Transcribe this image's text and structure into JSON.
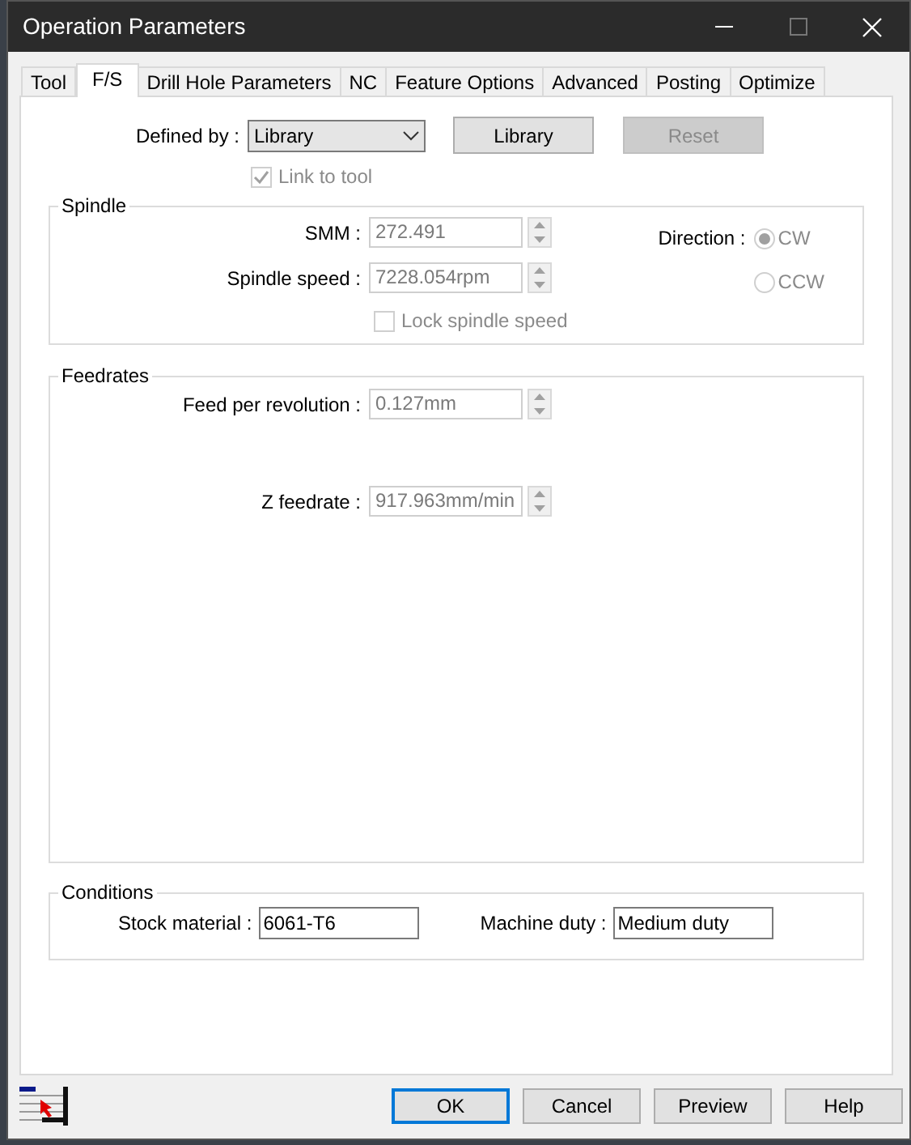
{
  "window": {
    "title": "Operation Parameters"
  },
  "tabs": [
    {
      "label": "Tool",
      "selected": false
    },
    {
      "label": "F/S",
      "selected": true
    },
    {
      "label": "Drill Hole Parameters",
      "selected": false
    },
    {
      "label": "NC",
      "selected": false
    },
    {
      "label": "Feature Options",
      "selected": false
    },
    {
      "label": "Advanced",
      "selected": false
    },
    {
      "label": "Posting",
      "selected": false
    },
    {
      "label": "Optimize",
      "selected": false
    }
  ],
  "defined_by": {
    "label": "Defined by :",
    "value": "Library"
  },
  "top_buttons": [
    {
      "label": "Library",
      "disabled": false
    },
    {
      "label": "Reset",
      "disabled": true
    }
  ],
  "link_to_tool": {
    "label": "Link to tool",
    "checked": true,
    "disabled": true
  },
  "spindle": {
    "title": "Spindle",
    "fields": [
      {
        "label": "SMM :",
        "value": "272.491",
        "disabled": true
      },
      {
        "label": "Spindle speed :",
        "value": "7228.054rpm",
        "disabled": true
      }
    ],
    "lock_spindle_speed": {
      "label": "Lock spindle speed",
      "checked": false,
      "disabled": true
    },
    "direction": {
      "label": "Direction :",
      "options": [
        {
          "label": "CW",
          "selected": true
        },
        {
          "label": "CCW",
          "selected": false
        }
      ]
    }
  },
  "feedrates": {
    "title": "Feedrates",
    "fields": [
      {
        "label": "Feed per revolution :",
        "value": "0.127mm",
        "disabled": true
      },
      {
        "label": "Z feedrate :",
        "value": "917.963mm/min",
        "disabled": true
      }
    ]
  },
  "conditions": {
    "title": "Conditions",
    "fields": [
      {
        "label": "Stock material :",
        "value": "6061-T6"
      },
      {
        "label": "Machine duty :",
        "value": "Medium duty"
      }
    ]
  },
  "footer_buttons": [
    {
      "label": "OK",
      "default": true
    },
    {
      "label": "Cancel",
      "default": false
    },
    {
      "label": "Preview",
      "default": false
    },
    {
      "label": "Help",
      "default": false
    }
  ]
}
